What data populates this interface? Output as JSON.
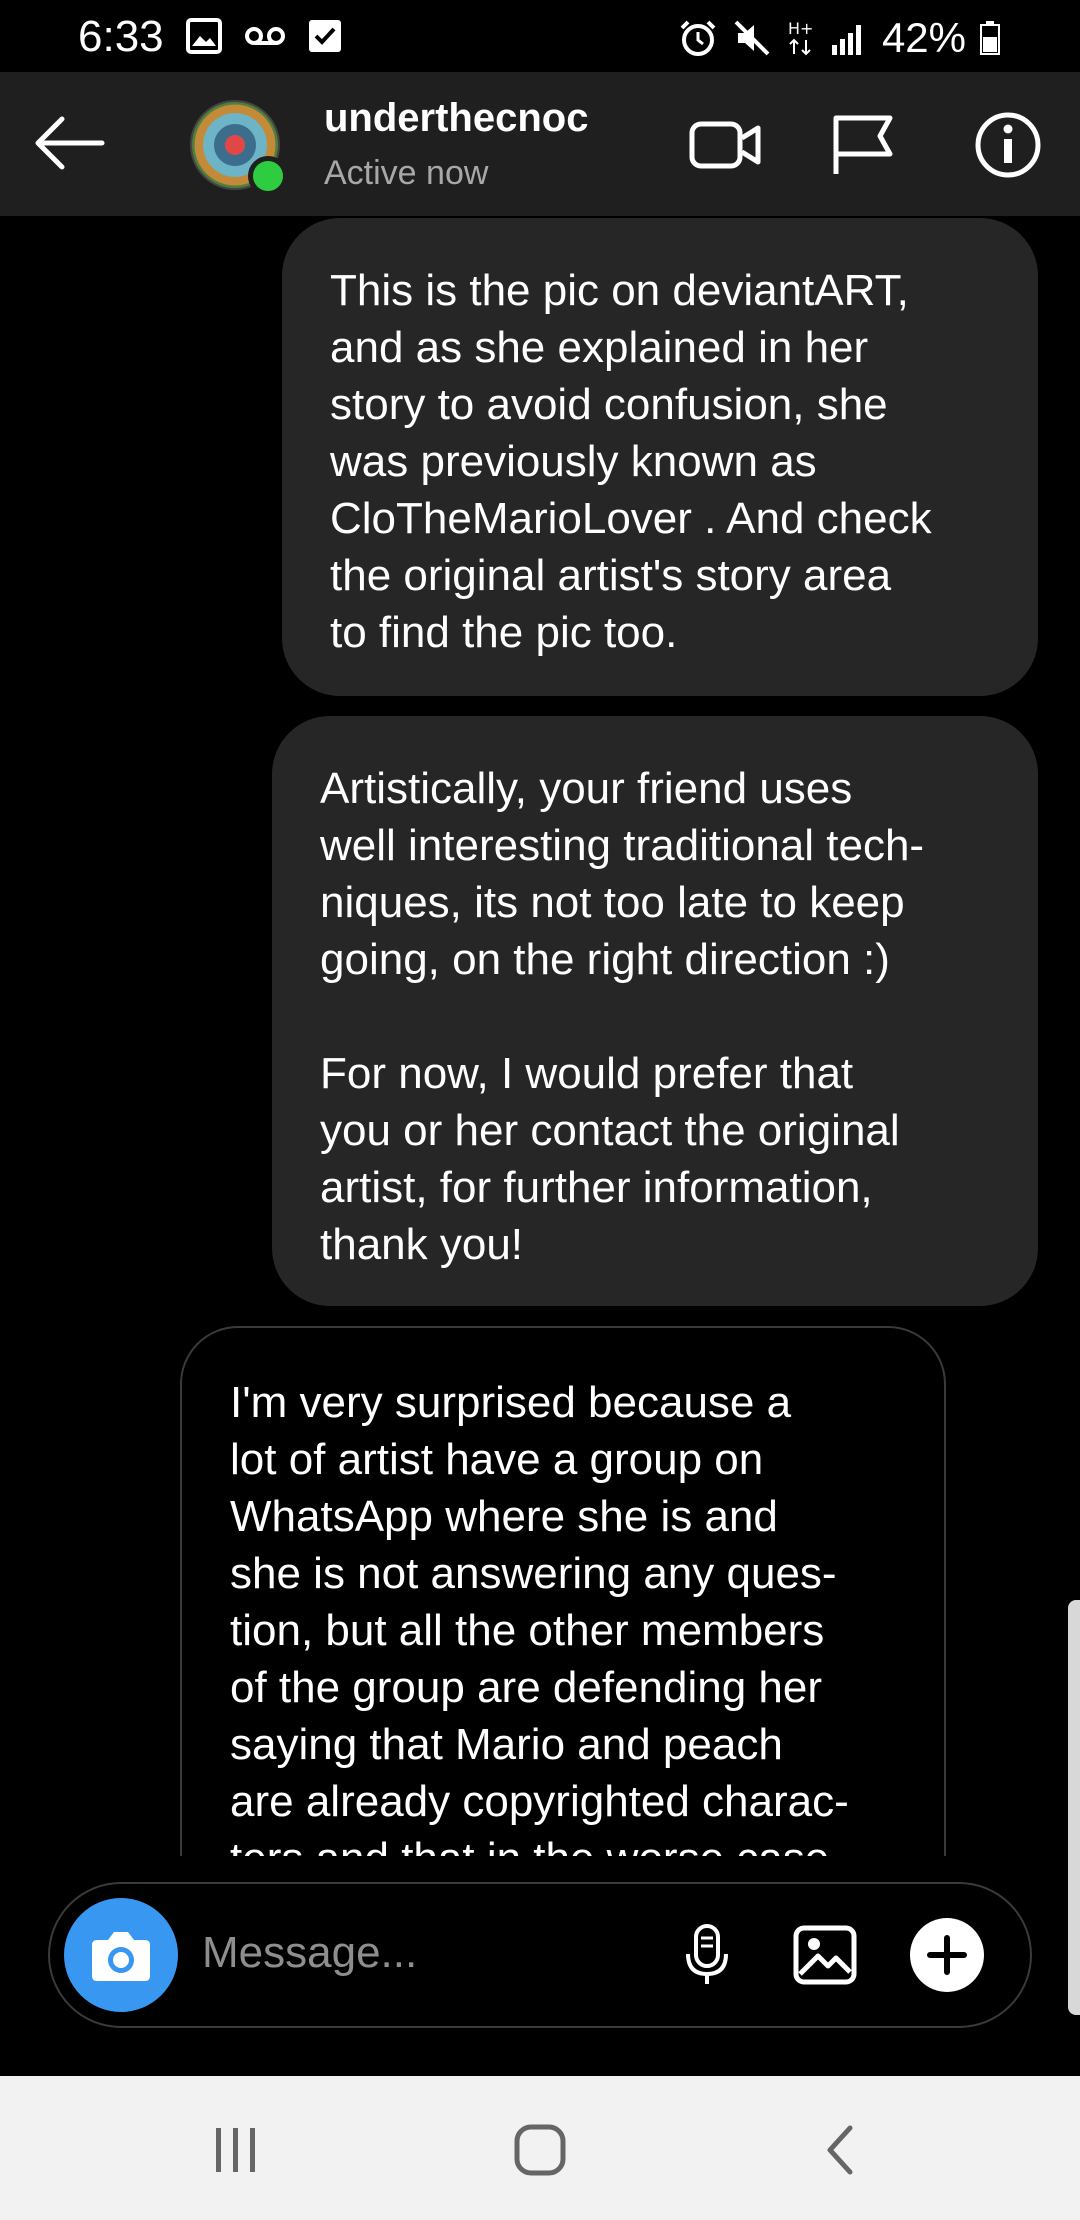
{
  "status_bar": {
    "time": "6:33",
    "battery": "42%",
    "left_icons": [
      "image-icon",
      "voicemail-icon",
      "checkbox-icon"
    ],
    "right_icons": [
      "alarm-icon",
      "mute-icon",
      "hplus-data-icon",
      "signal-icon",
      "battery-icon"
    ]
  },
  "header": {
    "username": "underthecnoc",
    "status": "Active now",
    "icons": [
      "back-arrow-icon",
      "video-call-icon",
      "flag-icon",
      "info-icon"
    ]
  },
  "messages": [
    {
      "sender": "me",
      "text": "This is the pic on deviantART,\nand as she explained in her\nstory to avoid confusion, she\nwas previously known as\nCloTheMarioLover . And check\nthe original artist's story area\nto find the pic too."
    },
    {
      "sender": "me",
      "text": "Artistically, your friend uses\nwell interesting traditional tech-\nniques, its not too late to keep\ngoing, on the right direction :)\n\nFor now, I would prefer that\nyou or her contact the original\nartist, for further information,\nthank you!"
    },
    {
      "sender": "them",
      "text": "I'm very surprised because a\nlot of artist have a group on\nWhatsApp where she is and\nshe is not answering any ques-\ntion, but all the other members\nof the group are defending her\nsaying that Mario and peach\nare already copyrighted charac-\nters and that in the worse case"
    }
  ],
  "composer": {
    "placeholder": "Message...",
    "icons": [
      "camera-icon",
      "microphone-icon",
      "gallery-icon",
      "plus-icon"
    ]
  },
  "nav": {
    "buttons": [
      "recents-icon",
      "home-icon",
      "back-icon"
    ]
  },
  "colors": {
    "background": "#000000",
    "header": "#1f1f1f",
    "my_bubble": "#262626",
    "accent_camera": "#3897f0",
    "online": "#2ecc40"
  }
}
